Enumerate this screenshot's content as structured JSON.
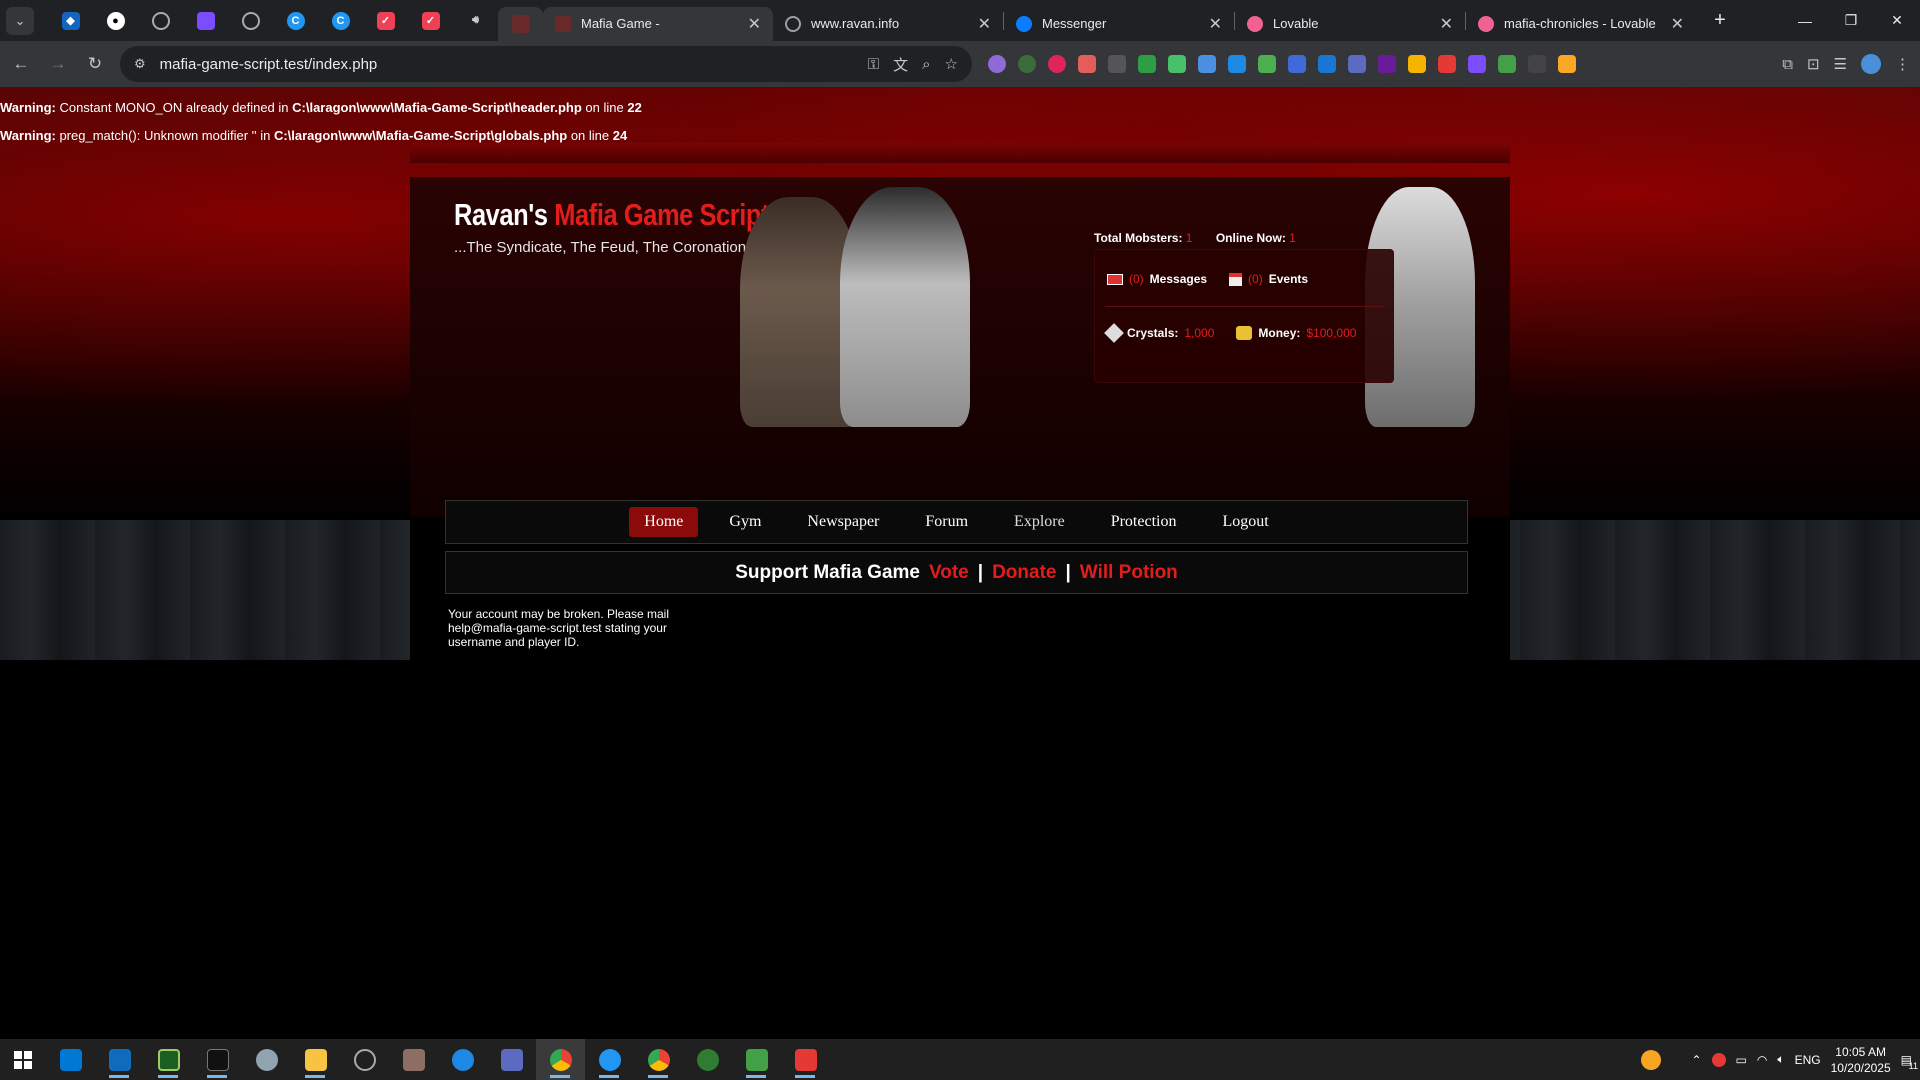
{
  "browser": {
    "tabs": [
      {
        "title": "Mafia Game -",
        "active": true,
        "favicon_color": "#6b2a2a"
      },
      {
        "title": "www.ravan.info",
        "active": false,
        "favicon_color": "#9aa0a6"
      },
      {
        "title": "Messenger",
        "active": false,
        "favicon_color": "#0a7cff"
      },
      {
        "title": "Lovable",
        "active": false,
        "favicon_color": "#f06292"
      },
      {
        "title": "mafia-chronicles - Lovable",
        "active": false,
        "favicon_color": "#f06292"
      }
    ],
    "pinned_icons": [
      "diamond-icon",
      "github-icon",
      "circle-icon",
      "chat-icon",
      "globe-icon",
      "c-logo-icon",
      "c-logo-icon",
      "pocket-icon",
      "pocket-icon",
      "speaker-icon"
    ],
    "address": "mafia-game-script.test/index.php",
    "window_controls": [
      "minimize",
      "restore",
      "close"
    ]
  },
  "warnings": [
    {
      "label": "Warning:",
      "text": " Constant MONO_ON already defined in ",
      "path": "C:\\laragon\\www\\Mafia-Game-Script\\header.php",
      "suffix": " on line ",
      "line": "22"
    },
    {
      "label": "Warning:",
      "text": " preg_match(): Unknown modifier '' in ",
      "path": "C:\\laragon\\www\\Mafia-Game-Script\\globals.php",
      "suffix": " on line ",
      "line": "24"
    }
  ],
  "header": {
    "logo_white": "Ravan's ",
    "logo_red": "Mafia Game Script",
    "tagline": "...The Syndicate, The Feud, The Coronation",
    "total_mobsters_label": "Total Mobsters:",
    "total_mobsters": "1",
    "online_now_label": "Online Now:",
    "online_now": "1",
    "messages_count": "(0)",
    "messages_label": "Messages",
    "events_count": "(0)",
    "events_label": "Events",
    "crystals_label": "Crystals:",
    "crystals": "1,000",
    "money_label": "Money:",
    "money": "$100,000"
  },
  "nav": {
    "items": [
      "Home",
      "Gym",
      "Newspaper",
      "Forum",
      "Explore",
      "Protection",
      "Logout"
    ],
    "active": "Home"
  },
  "support": {
    "label": "Support Mafia Game",
    "links": [
      "Vote",
      "Donate",
      "Will Potion"
    ],
    "separator": "|"
  },
  "notice": "Your account may be broken. Please mail help@mafia-game-script.test stating your username and player ID.",
  "taskbar": {
    "language": "ENG",
    "time": "10:05 AM",
    "date": "10/20/2025",
    "notifications": "11"
  }
}
